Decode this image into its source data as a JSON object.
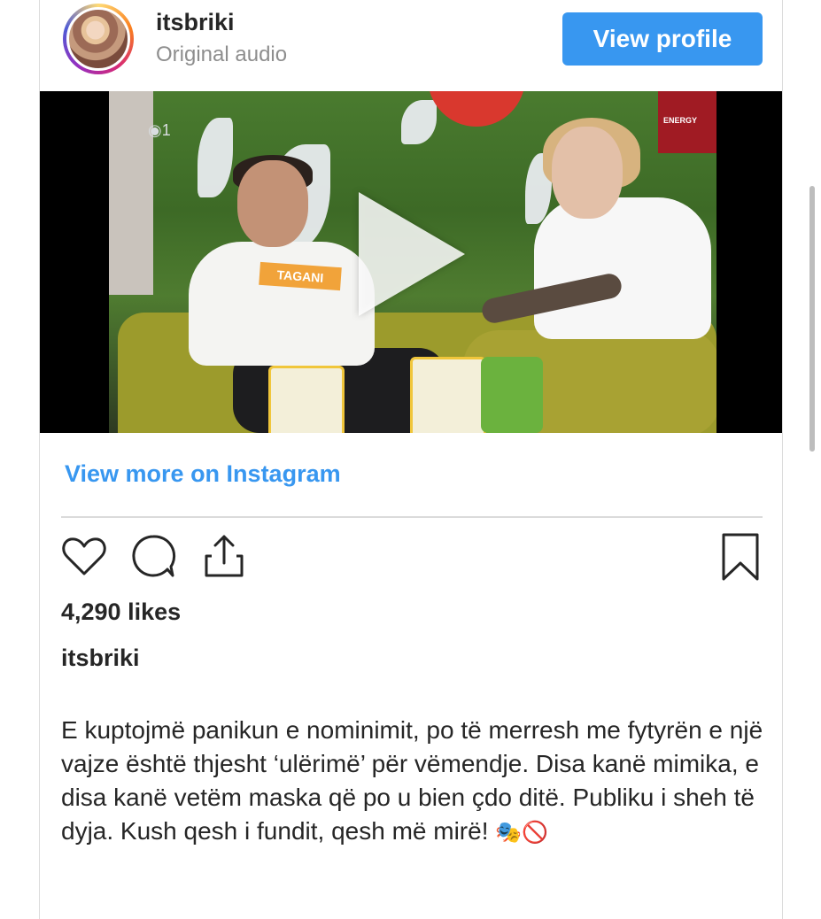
{
  "header": {
    "username": "itsbriki",
    "subtitle": "Original audio",
    "view_profile_label": "View profile"
  },
  "media": {
    "type": "video",
    "shirt_tag_text": "TAGANI",
    "sign_text": "ENERGY",
    "viewer_count": "1"
  },
  "view_more_label": "View more on Instagram",
  "actions": {
    "icons": [
      "heart-icon",
      "comment-icon",
      "share-icon",
      "bookmark-icon"
    ]
  },
  "likes_text": "4,290 likes",
  "caption": {
    "owner": "itsbriki",
    "text": "E kuptojmë panikun e nominimit, po të merresh me fytyrën e një vajze është thjesht ‘ulërimë’ për vëmendje. Disa kanë mimika, e disa kanë vetëm maska që po u bien çdo ditë. Publiku i sheh të dyja. Kush qesh i fundit, qesh më mirë!",
    "emojis": "🎭🚫"
  },
  "colors": {
    "accent": "#3897f0",
    "text": "#262626",
    "muted": "#8e8e8e",
    "divider": "#dbdbdb"
  }
}
